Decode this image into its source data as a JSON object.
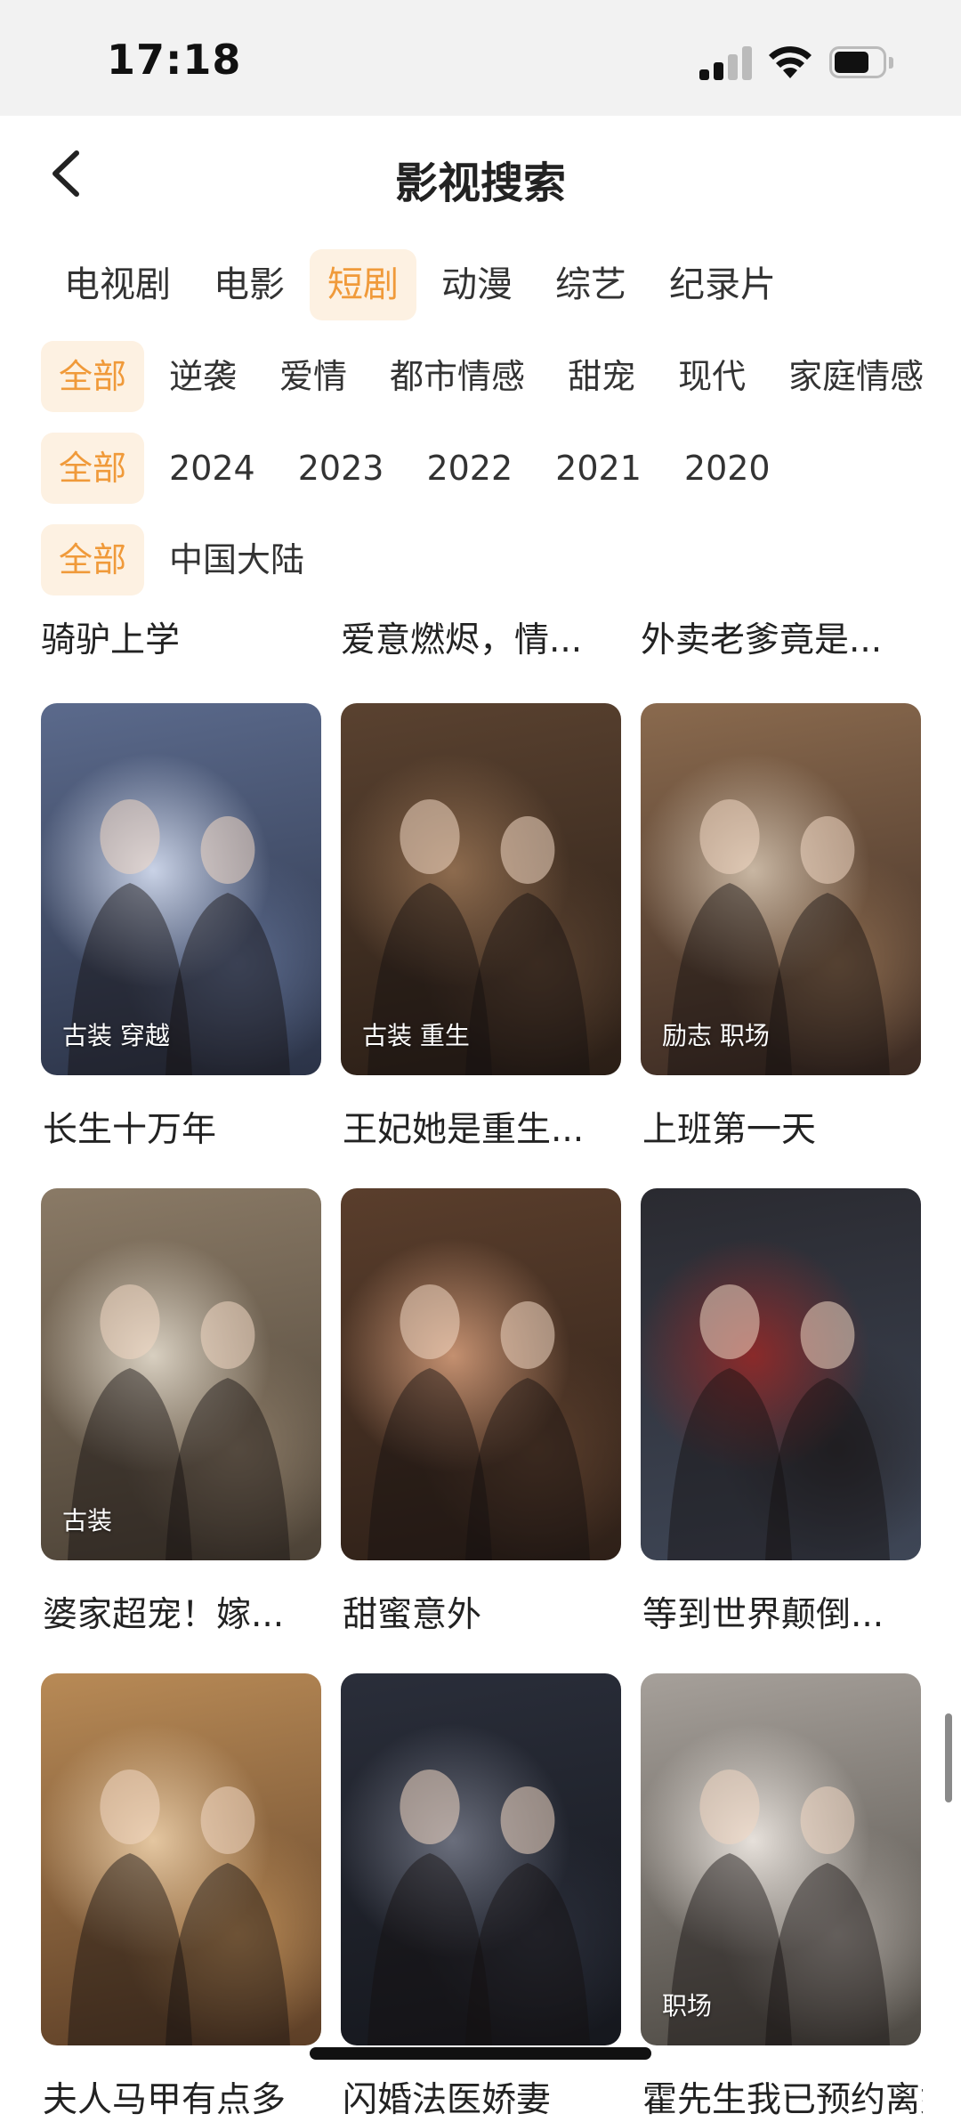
{
  "status": {
    "time": "17:18"
  },
  "header": {
    "title": "影视搜索"
  },
  "categories": [
    {
      "label": "电视剧",
      "active": false
    },
    {
      "label": "电影",
      "active": false
    },
    {
      "label": "短剧",
      "active": true
    },
    {
      "label": "动漫",
      "active": false
    },
    {
      "label": "综艺",
      "active": false
    },
    {
      "label": "纪录片",
      "active": false
    }
  ],
  "genres": [
    "全部",
    "逆袭",
    "爱情",
    "都市情感",
    "甜宠",
    "现代",
    "家庭情感"
  ],
  "years": [
    "全部",
    "2024",
    "2023",
    "2022",
    "2021",
    "2020"
  ],
  "regions": [
    "全部",
    "中国大陆"
  ],
  "top_titles": [
    "骑驴上学",
    "爱意燃烬，情...",
    "外卖老爹竟是..."
  ],
  "cards": [
    {
      "title": "长生十万年",
      "tag": "古装 穿越",
      "colors": [
        "#5b6a8c",
        "#c9d2e6",
        "#2b3347"
      ]
    },
    {
      "title": "王妃她是重生...",
      "tag": "古装 重生",
      "colors": [
        "#5a4230",
        "#8d6b4e",
        "#2a1e16"
      ]
    },
    {
      "title": "上班第一天",
      "tag": "励志 职场",
      "colors": [
        "#8a6a4e",
        "#c8b6a2",
        "#3b2a22"
      ]
    },
    {
      "title": "婆家超宠！嫁...",
      "tag": "古装",
      "colors": [
        "#8a7a66",
        "#d8cfc0",
        "#4c4236"
      ]
    },
    {
      "title": "甜蜜意外",
      "tag": "",
      "colors": [
        "#5a3e2c",
        "#c49070",
        "#2e2018"
      ]
    },
    {
      "title": "等到世界颠倒...",
      "tag": "",
      "colors": [
        "#2a2a30",
        "#8a2a2a",
        "#3e4656"
      ]
    },
    {
      "title": "夫人马甲有点多",
      "tag": "",
      "colors": [
        "#b88a56",
        "#e4c6a0",
        "#5c3e26"
      ]
    },
    {
      "title": "闪婚法医娇妻",
      "tag": "",
      "colors": [
        "#2a2e3a",
        "#6a6e7c",
        "#15171d"
      ]
    },
    {
      "title": "霍先生我已预约离婚",
      "tag": "职场",
      "colors": [
        "#a6a09a",
        "#e6e0da",
        "#4c4842"
      ]
    }
  ]
}
